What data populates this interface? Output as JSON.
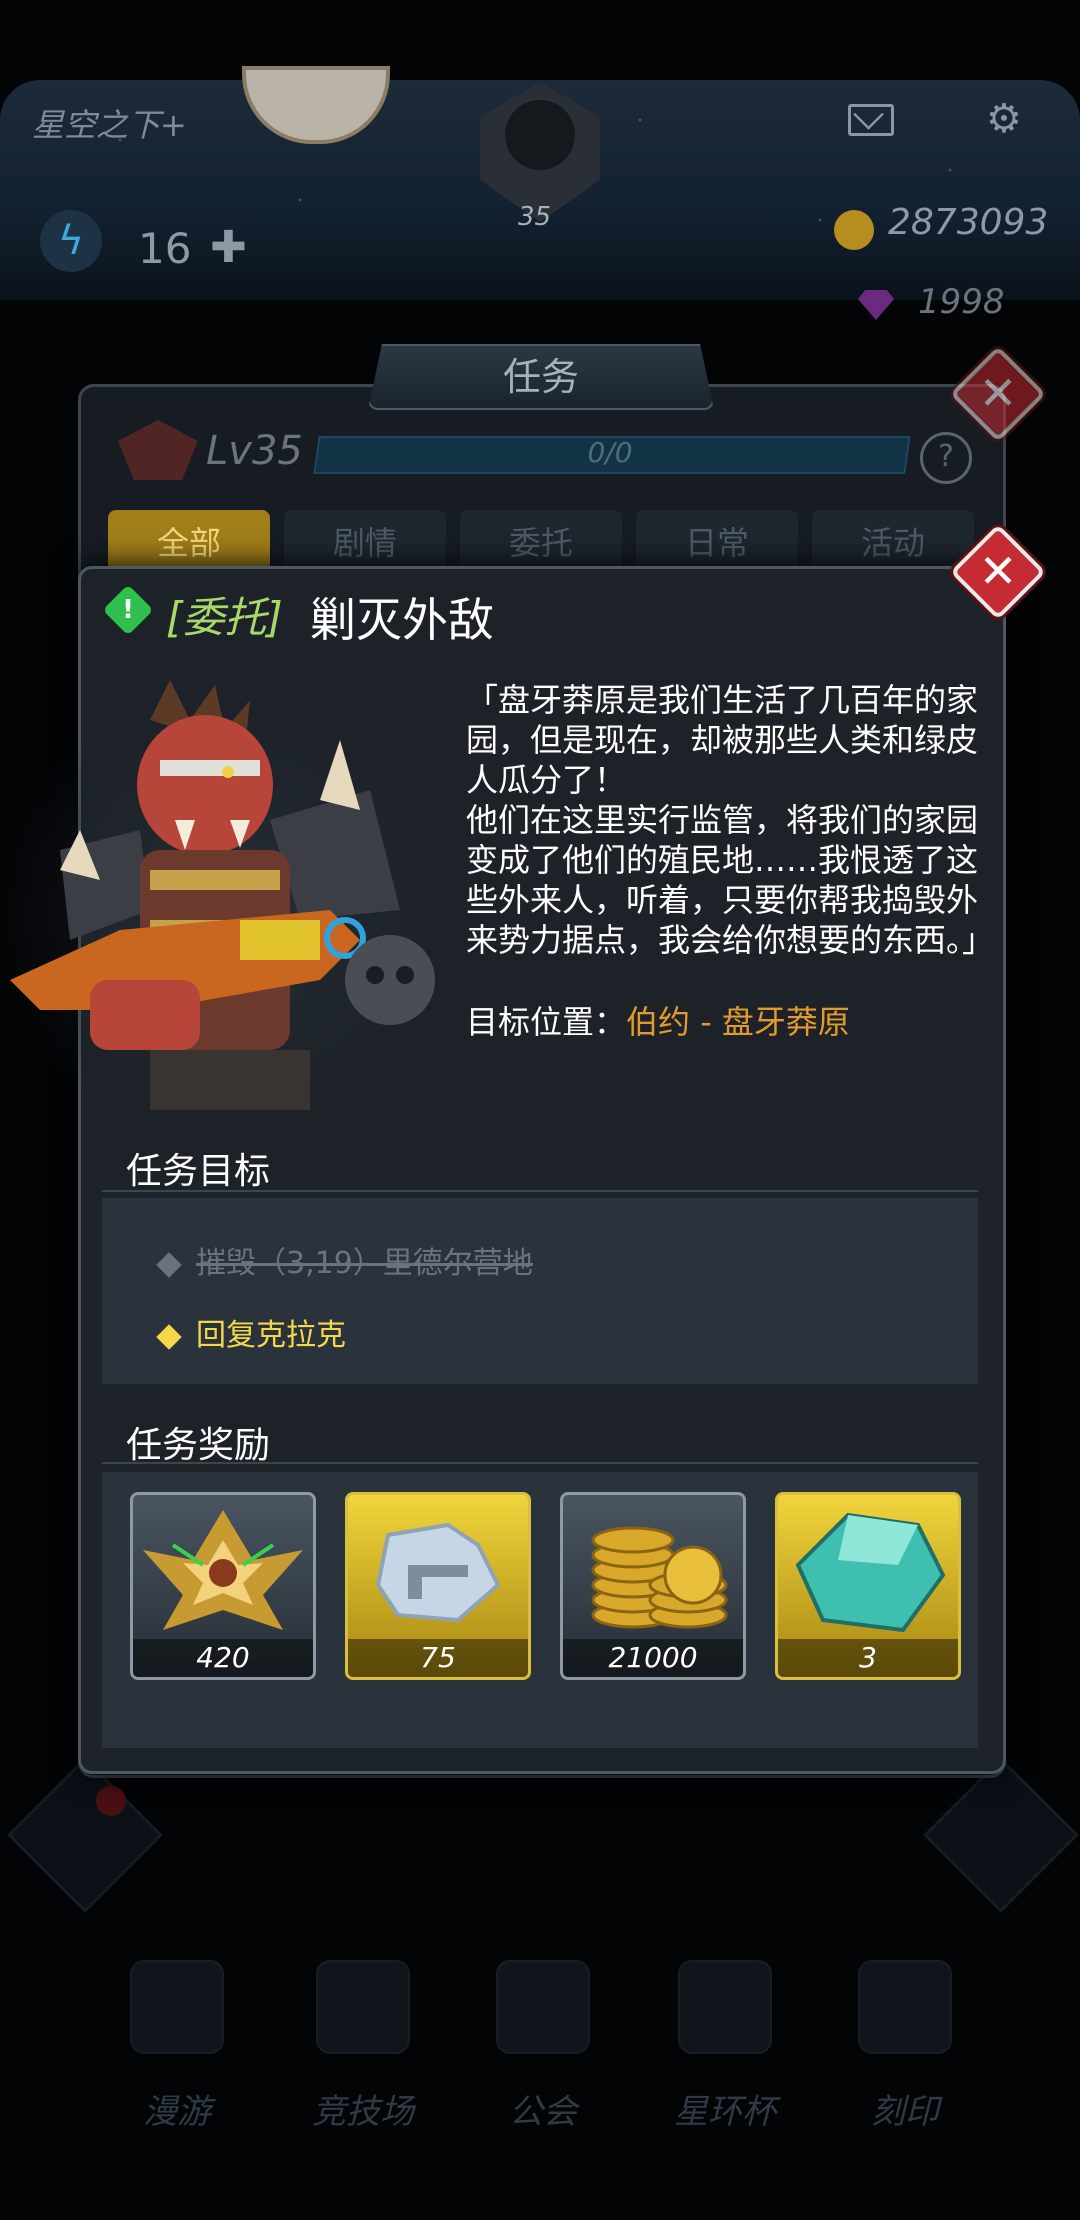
{
  "hud": {
    "player_name": "星空之下+",
    "level": "35",
    "energy": "16",
    "coins": "2873093",
    "gems": "1998"
  },
  "task_panel": {
    "title": "任务",
    "level": "Lv35",
    "progress_text": "0/0",
    "help": "?",
    "tabs": [
      "全部",
      "剧情",
      "委托",
      "日常",
      "活动"
    ],
    "active_tab": "全部"
  },
  "quest": {
    "type_label": "[委托]",
    "title": "剿灭外敌",
    "description": "「盘牙莽原是我们生活了几百年的家园，但是现在，却被那些人类和绿皮人瓜分了！\n他们在这里实行监管，将我们的家园变成了他们的殖民地……我恨透了这些外来人，听着，只要你帮我捣毁外来势力据点，我会给你想要的东西。」",
    "target_label": "目标位置：",
    "target_location": "伯约 - 盘牙莽原"
  },
  "objectives": {
    "header": "任务目标",
    "items": [
      {
        "text": "摧毁（3,19）里德尔营地",
        "done": true
      },
      {
        "text": "回复克拉克",
        "done": false
      }
    ]
  },
  "rewards": {
    "header": "任务奖励",
    "items": [
      {
        "icon": "rank-xp-icon",
        "qty": "420",
        "rarity": "grey"
      },
      {
        "icon": "weapon-blueprint-icon",
        "qty": "75",
        "rarity": "gold"
      },
      {
        "icon": "gold-coins-icon",
        "qty": "21000",
        "rarity": "grey"
      },
      {
        "icon": "crystal-icon",
        "qty": "3",
        "rarity": "gold"
      }
    ]
  },
  "nav": {
    "items": [
      "漫游",
      "竞技场",
      "公会",
      "星环杯",
      "刻印"
    ]
  },
  "colors": {
    "accent_gold": "#a07e1a",
    "objective_active": "#f5d84a",
    "location": "#e39a2c",
    "quest_type": "#a9d86a",
    "close_red": "#c42b32"
  }
}
